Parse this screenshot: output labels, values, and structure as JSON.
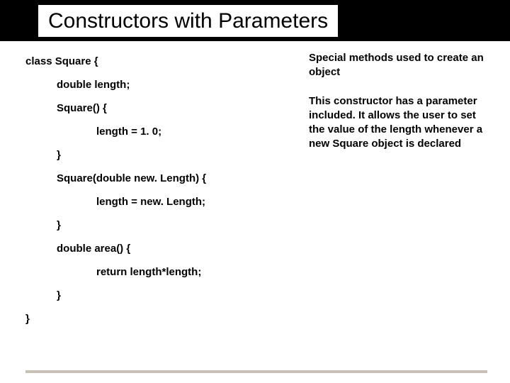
{
  "title": "Constructors with Parameters",
  "code": {
    "l0": "class Square {",
    "l1": "double length;",
    "l2": "Square() {",
    "l3": "length = 1. 0;",
    "l4": "}",
    "l5": "Square(double new. Length) {",
    "l6": "length = new. Length;",
    "l7": "}",
    "l8": "double area() {",
    "l9": "return length*length;",
    "l10": "}",
    "l11": "}"
  },
  "notes": {
    "n1": "Special methods used to create an object",
    "n2": "This constructor has a parameter included. It allows the user to set the value of the length whenever a new Square object is declared"
  }
}
